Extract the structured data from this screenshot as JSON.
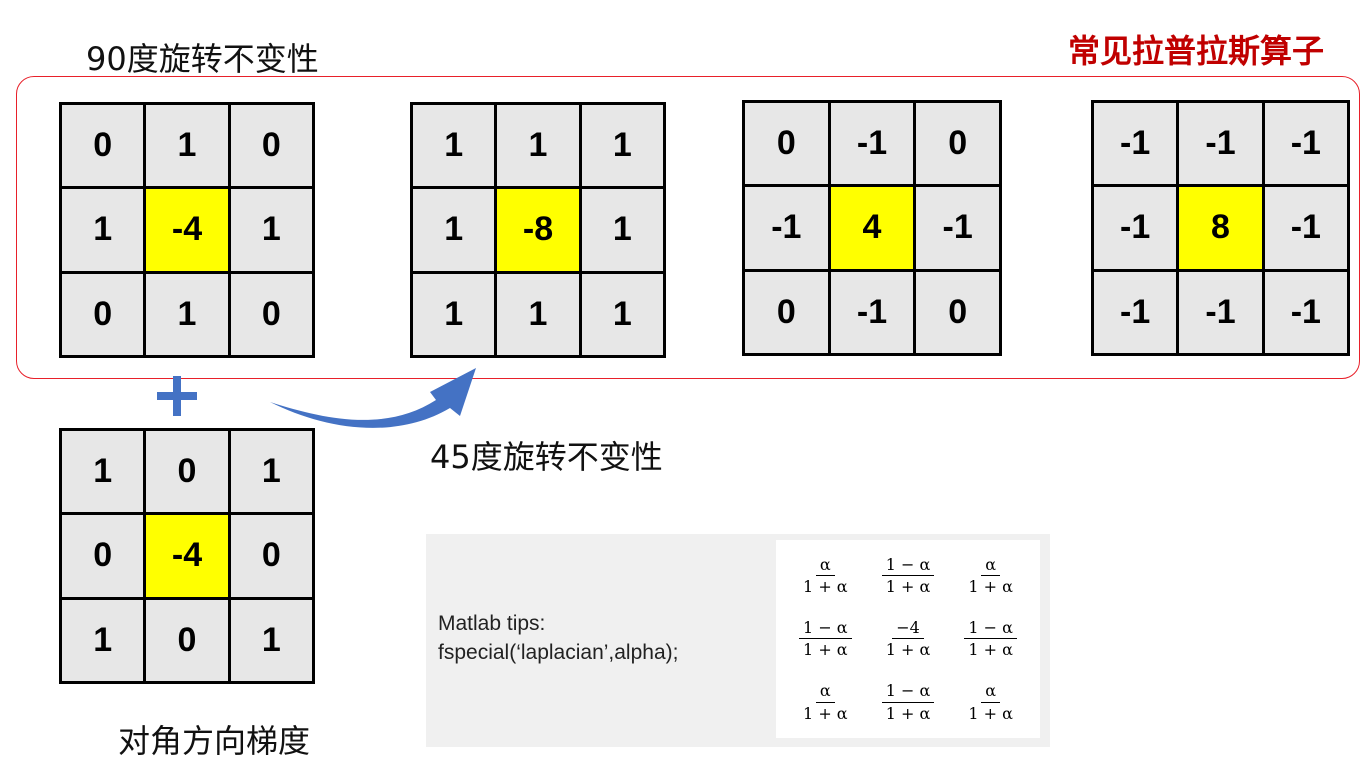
{
  "labels": {
    "rot90": "90度旋转不变性",
    "common": "常见拉普拉斯算子",
    "rot45": "45度旋转不变性",
    "diagonal": "对角方向梯度"
  },
  "kernels": {
    "k90": [
      [
        "0",
        "1",
        "0"
      ],
      [
        "1",
        "-4",
        "1"
      ],
      [
        "0",
        "1",
        "0"
      ]
    ],
    "k45": [
      [
        "1",
        "1",
        "1"
      ],
      [
        "1",
        "-8",
        "1"
      ],
      [
        "1",
        "1",
        "1"
      ]
    ],
    "k90neg": [
      [
        "0",
        "-1",
        "0"
      ],
      [
        "-1",
        "4",
        "-1"
      ],
      [
        "0",
        "-1",
        "0"
      ]
    ],
    "k45neg": [
      [
        "-1",
        "-1",
        "-1"
      ],
      [
        "-1",
        "8",
        "-1"
      ],
      [
        "-1",
        "-1",
        "-1"
      ]
    ],
    "kdiag": [
      [
        "1",
        "0",
        "1"
      ],
      [
        "0",
        "-4",
        "0"
      ],
      [
        "1",
        "0",
        "1"
      ]
    ]
  },
  "icons": {
    "plus": "plus-icon",
    "arrow": "curved-arrow-icon"
  },
  "colors": {
    "highlight": "#ffff00",
    "cell": "#e7e7e7",
    "accent": "#c00000",
    "frame": "#e8202a",
    "arrow": "#4472c4"
  },
  "tips": {
    "label": "Matlab tips:",
    "code": "fspecial(‘laplacian’,alpha);"
  },
  "formula": [
    [
      {
        "num": "α",
        "den": "1 + α"
      },
      {
        "num": "1 − α",
        "den": "1 + α"
      },
      {
        "num": "α",
        "den": "1 + α"
      }
    ],
    [
      {
        "num": "1 − α",
        "den": "1 + α"
      },
      {
        "num": "−4",
        "den": "1 + α"
      },
      {
        "num": "1 − α",
        "den": "1 + α"
      }
    ],
    [
      {
        "num": "α",
        "den": "1 + α"
      },
      {
        "num": "1 − α",
        "den": "1 + α"
      },
      {
        "num": "α",
        "den": "1 + α"
      }
    ]
  ]
}
